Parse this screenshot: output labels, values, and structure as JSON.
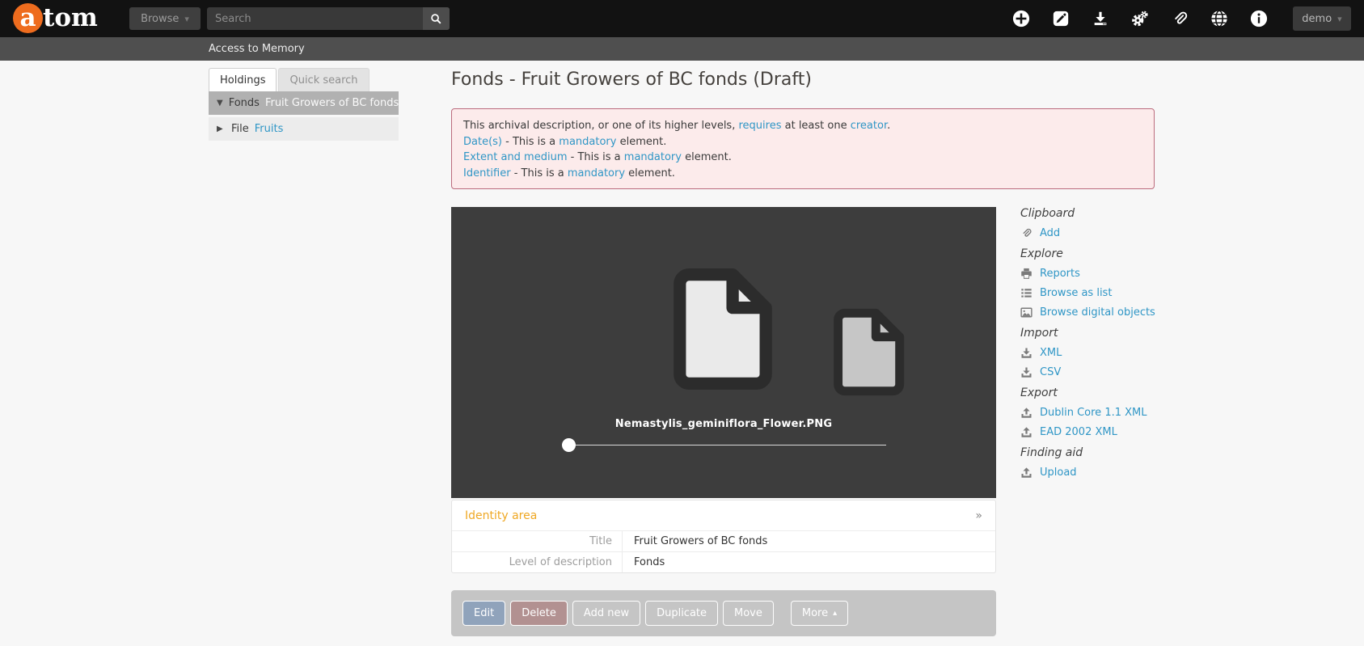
{
  "glyphs": {
    "caret_down": "▾",
    "caret_up": "▴",
    "expanded": "▼",
    "collapsed": "▶",
    "chevron": "»"
  },
  "header": {
    "logo_a": "a",
    "logo_rest": "tom",
    "browse_label": "Browse",
    "search_placeholder": "Search",
    "user_label": "demo",
    "icons": [
      {
        "name": "add"
      },
      {
        "name": "edit"
      },
      {
        "name": "import"
      },
      {
        "name": "admin"
      },
      {
        "name": "clipboard"
      },
      {
        "name": "language"
      },
      {
        "name": "quick-links"
      }
    ]
  },
  "breadcrumb": "Access to Memory",
  "sidebar": {
    "tabs": [
      {
        "label": "Holdings"
      },
      {
        "label": "Quick search"
      }
    ],
    "tree": [
      {
        "level": "Fonds",
        "title": "Fruit Growers of BC fonds"
      },
      {
        "level": "File",
        "title": "Fruits"
      }
    ]
  },
  "content": {
    "page_title": "Fonds - Fruit Growers of BC fonds (Draft)",
    "messages": [
      {
        "parts": [
          "This archival description, or one of its higher levels, ",
          "requires",
          " at least one ",
          "creator",
          "."
        ]
      },
      {
        "parts": [
          "Date(s)",
          " - This is a ",
          "mandatory",
          " element."
        ]
      },
      {
        "parts": [
          "Extent and medium",
          " - This is a ",
          "mandatory",
          " element."
        ]
      },
      {
        "parts": [
          "Identifier",
          " - This is a ",
          "mandatory",
          " element."
        ]
      }
    ],
    "carousel": {
      "filename": "Nemastylis_geminiflora_Flower.PNG"
    },
    "identity": {
      "heading": "Identity area",
      "rows": [
        {
          "label": "Title",
          "value": "Fruit Growers of BC fonds"
        },
        {
          "label": "Level of description",
          "value": "Fonds"
        }
      ]
    },
    "actions": [
      {
        "label": "Edit"
      },
      {
        "label": "Delete"
      },
      {
        "label": "Add new"
      },
      {
        "label": "Duplicate"
      },
      {
        "label": "Move"
      },
      {
        "label": "More"
      }
    ]
  },
  "context_menu": {
    "sections": [
      {
        "heading": "Clipboard",
        "links": [
          {
            "icon": "paperclip",
            "label": "Add"
          }
        ]
      },
      {
        "heading": "Explore",
        "links": [
          {
            "icon": "printer",
            "label": "Reports"
          },
          {
            "icon": "list",
            "label": "Browse as list"
          },
          {
            "icon": "image",
            "label": "Browse digital objects"
          }
        ]
      },
      {
        "heading": "Import",
        "links": [
          {
            "icon": "download",
            "label": "XML"
          },
          {
            "icon": "download",
            "label": "CSV"
          }
        ]
      },
      {
        "heading": "Export",
        "links": [
          {
            "icon": "upload",
            "label": "Dublin Core 1.1 XML"
          },
          {
            "icon": "upload",
            "label": "EAD 2002 XML"
          }
        ]
      },
      {
        "heading": "Finding aid",
        "links": [
          {
            "icon": "upload",
            "label": "Upload"
          }
        ]
      }
    ]
  },
  "colors": {
    "brand_orange": "#ee6c1e",
    "link_blue": "#2f96c6",
    "heading_orange": "#efa824",
    "error_bg": "#fcebeb",
    "error_border": "#bb6b7d",
    "edit_button": "#90a3bb",
    "delete_button": "#b29191",
    "carousel_bg": "#3d3d3d",
    "topbar": "#121212",
    "breadcrumb_bar": "#4f4f4f"
  }
}
